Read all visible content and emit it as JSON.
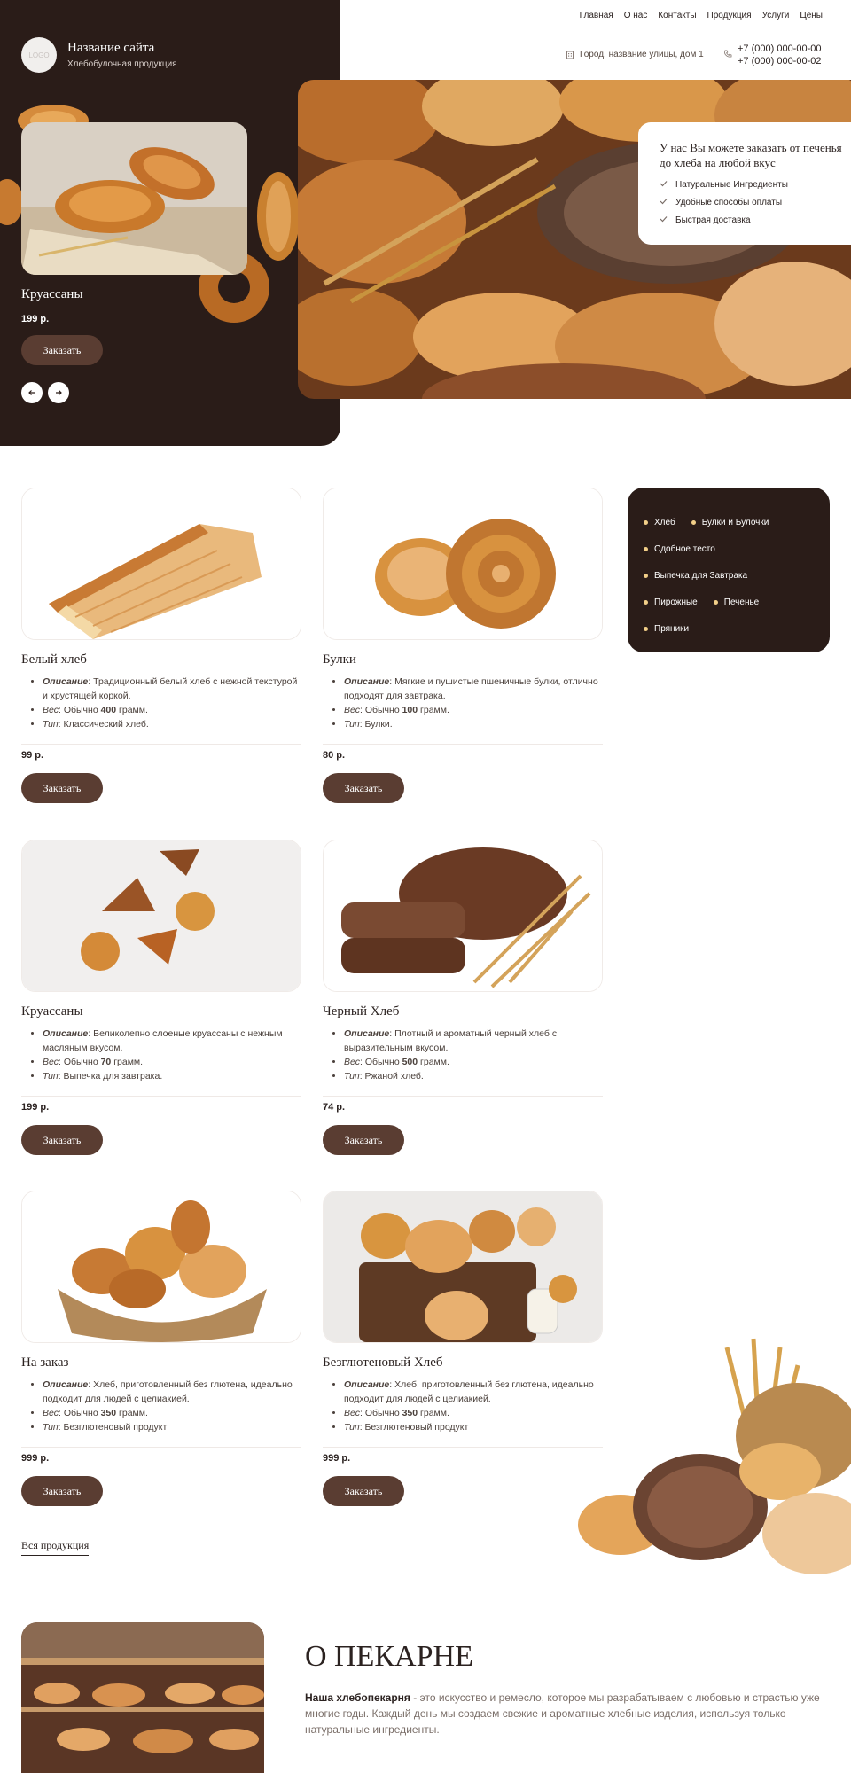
{
  "header": {
    "logo_text": "LOGO",
    "site_name": "Название сайта",
    "site_sub": "Хлебобулочная продукция",
    "nav": [
      "Главная",
      "О нас",
      "Контакты",
      "Продукция",
      "Услуги",
      "Цены"
    ],
    "address": "Город, название улицы, дом 1",
    "phones": [
      "+7 (000) 000-00-00",
      "+7 (000) 000-00-02"
    ]
  },
  "slider": {
    "title": "Круассаны",
    "price": "199 р.",
    "button": "Заказать"
  },
  "hero_card": {
    "title": "У нас Вы можете заказать от печенья до хлеба на любой вкус",
    "items": [
      "Натуральные Ингредиенты",
      "Удобные способы оплаты",
      "Быстрая доставка"
    ]
  },
  "categories": [
    [
      "Хлеб",
      "Булки и Булочки"
    ],
    [
      "Сдобное тесто"
    ],
    [
      "Выпечка для Завтрака"
    ],
    [
      "Пирожные",
      "Печенье"
    ],
    [
      "Пряники"
    ]
  ],
  "products": [
    {
      "title": "Белый хлеб",
      "desc_label": "Описание",
      "desc": "Традиционный белый хлеб с нежной текстурой и хрустящей коркой.",
      "weight_label": "Вес",
      "weight_pre": "Обычно",
      "weight": "400",
      "weight_post": "грамм.",
      "type_label": "Тип",
      "type": "Классический хлеб.",
      "price": "99 р.",
      "button": "Заказать"
    },
    {
      "title": "Булки",
      "desc_label": "Описание",
      "desc": "Мягкие и пушистые пшеничные булки, отлично подходят для завтрака.",
      "weight_label": "Вес",
      "weight_pre": "Обычно",
      "weight": "100",
      "weight_post": "грамм.",
      "type_label": "Тип",
      "type": "Булки.",
      "price": "80 р.",
      "button": "Заказать"
    },
    {
      "title": "Круассаны",
      "desc_label": "Описание",
      "desc": "Великолепно слоеные круассаны с нежным масляным вкусом.",
      "weight_label": "Вес",
      "weight_pre": "Обычно",
      "weight": "70",
      "weight_post": "грамм.",
      "type_label": "Тип",
      "type": "Выпечка для завтрака.",
      "price": "199 р.",
      "button": "Заказать"
    },
    {
      "title": "Черный Хлеб",
      "desc_label": "Описание",
      "desc": "Плотный и ароматный черный хлеб с выразительным вкусом.",
      "weight_label": "Вес",
      "weight_pre": "Обычно",
      "weight": "500",
      "weight_post": "грамм.",
      "type_label": "Тип",
      "type": "Ржаной хлеб.",
      "price": "74 р.",
      "button": "Заказать"
    },
    {
      "title": "На заказ",
      "desc_label": "Описание",
      "desc": "Хлеб, приготовленный без глютена, идеально подходит для людей с целиакией.",
      "weight_label": "Вес",
      "weight_pre": "Обычно",
      "weight": "350",
      "weight_post": "грамм.",
      "type_label": "Тип",
      "type": "Безглютеновый продукт",
      "price": "999 р.",
      "button": "Заказать"
    },
    {
      "title": "Безглютеновый Хлеб",
      "desc_label": "Описание",
      "desc": "Хлеб, приготовленный без глютена, идеально подходит для людей с целиакией.",
      "weight_label": "Вес",
      "weight_pre": "Обычно",
      "weight": "350",
      "weight_post": "грамм.",
      "type_label": "Тип",
      "type": "Безглютеновый продукт",
      "price": "999 р.",
      "button": "Заказать"
    }
  ],
  "all_products": "Вся продукция",
  "about": {
    "title": "О ПЕКАРНЕ",
    "lead": "Наша хлебопекарня",
    "text": " - это искусство и ремесло, которое мы разрабатываем с любовью и страстью уже многие годы. Каждый день мы создаем свежие и ароматные хлебные изделия, используя только натуральные ингредиенты."
  },
  "colors": {
    "dark": "#2a1c18",
    "button": "#5a3d32",
    "accent_dot": "#f2cf88"
  }
}
